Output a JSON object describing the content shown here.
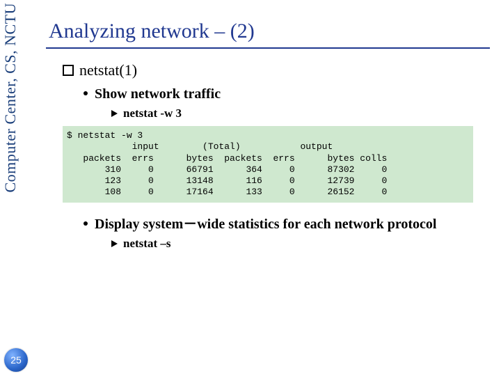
{
  "sidebar": {
    "label": "Computer Center, CS, NCTU",
    "page_number": "25"
  },
  "title": "Analyzing network – (2)",
  "l1_netstat": "netstat(1)",
  "l2_show_traffic": "Show network traffic",
  "l3_netstat_w3": "netstat -w 3",
  "terminal_block": "$ netstat -w 3\n            input        (Total)           output\n   packets  errs      bytes  packets  errs      bytes colls\n       310     0      66791      364     0      87302     0\n       123     0      13148      116     0      12739     0\n       108     0      17164      133     0      26152     0",
  "l2_display_stats": "Display system－wide statistics for each network protocol",
  "l3_netstat_s": "netstat –s"
}
